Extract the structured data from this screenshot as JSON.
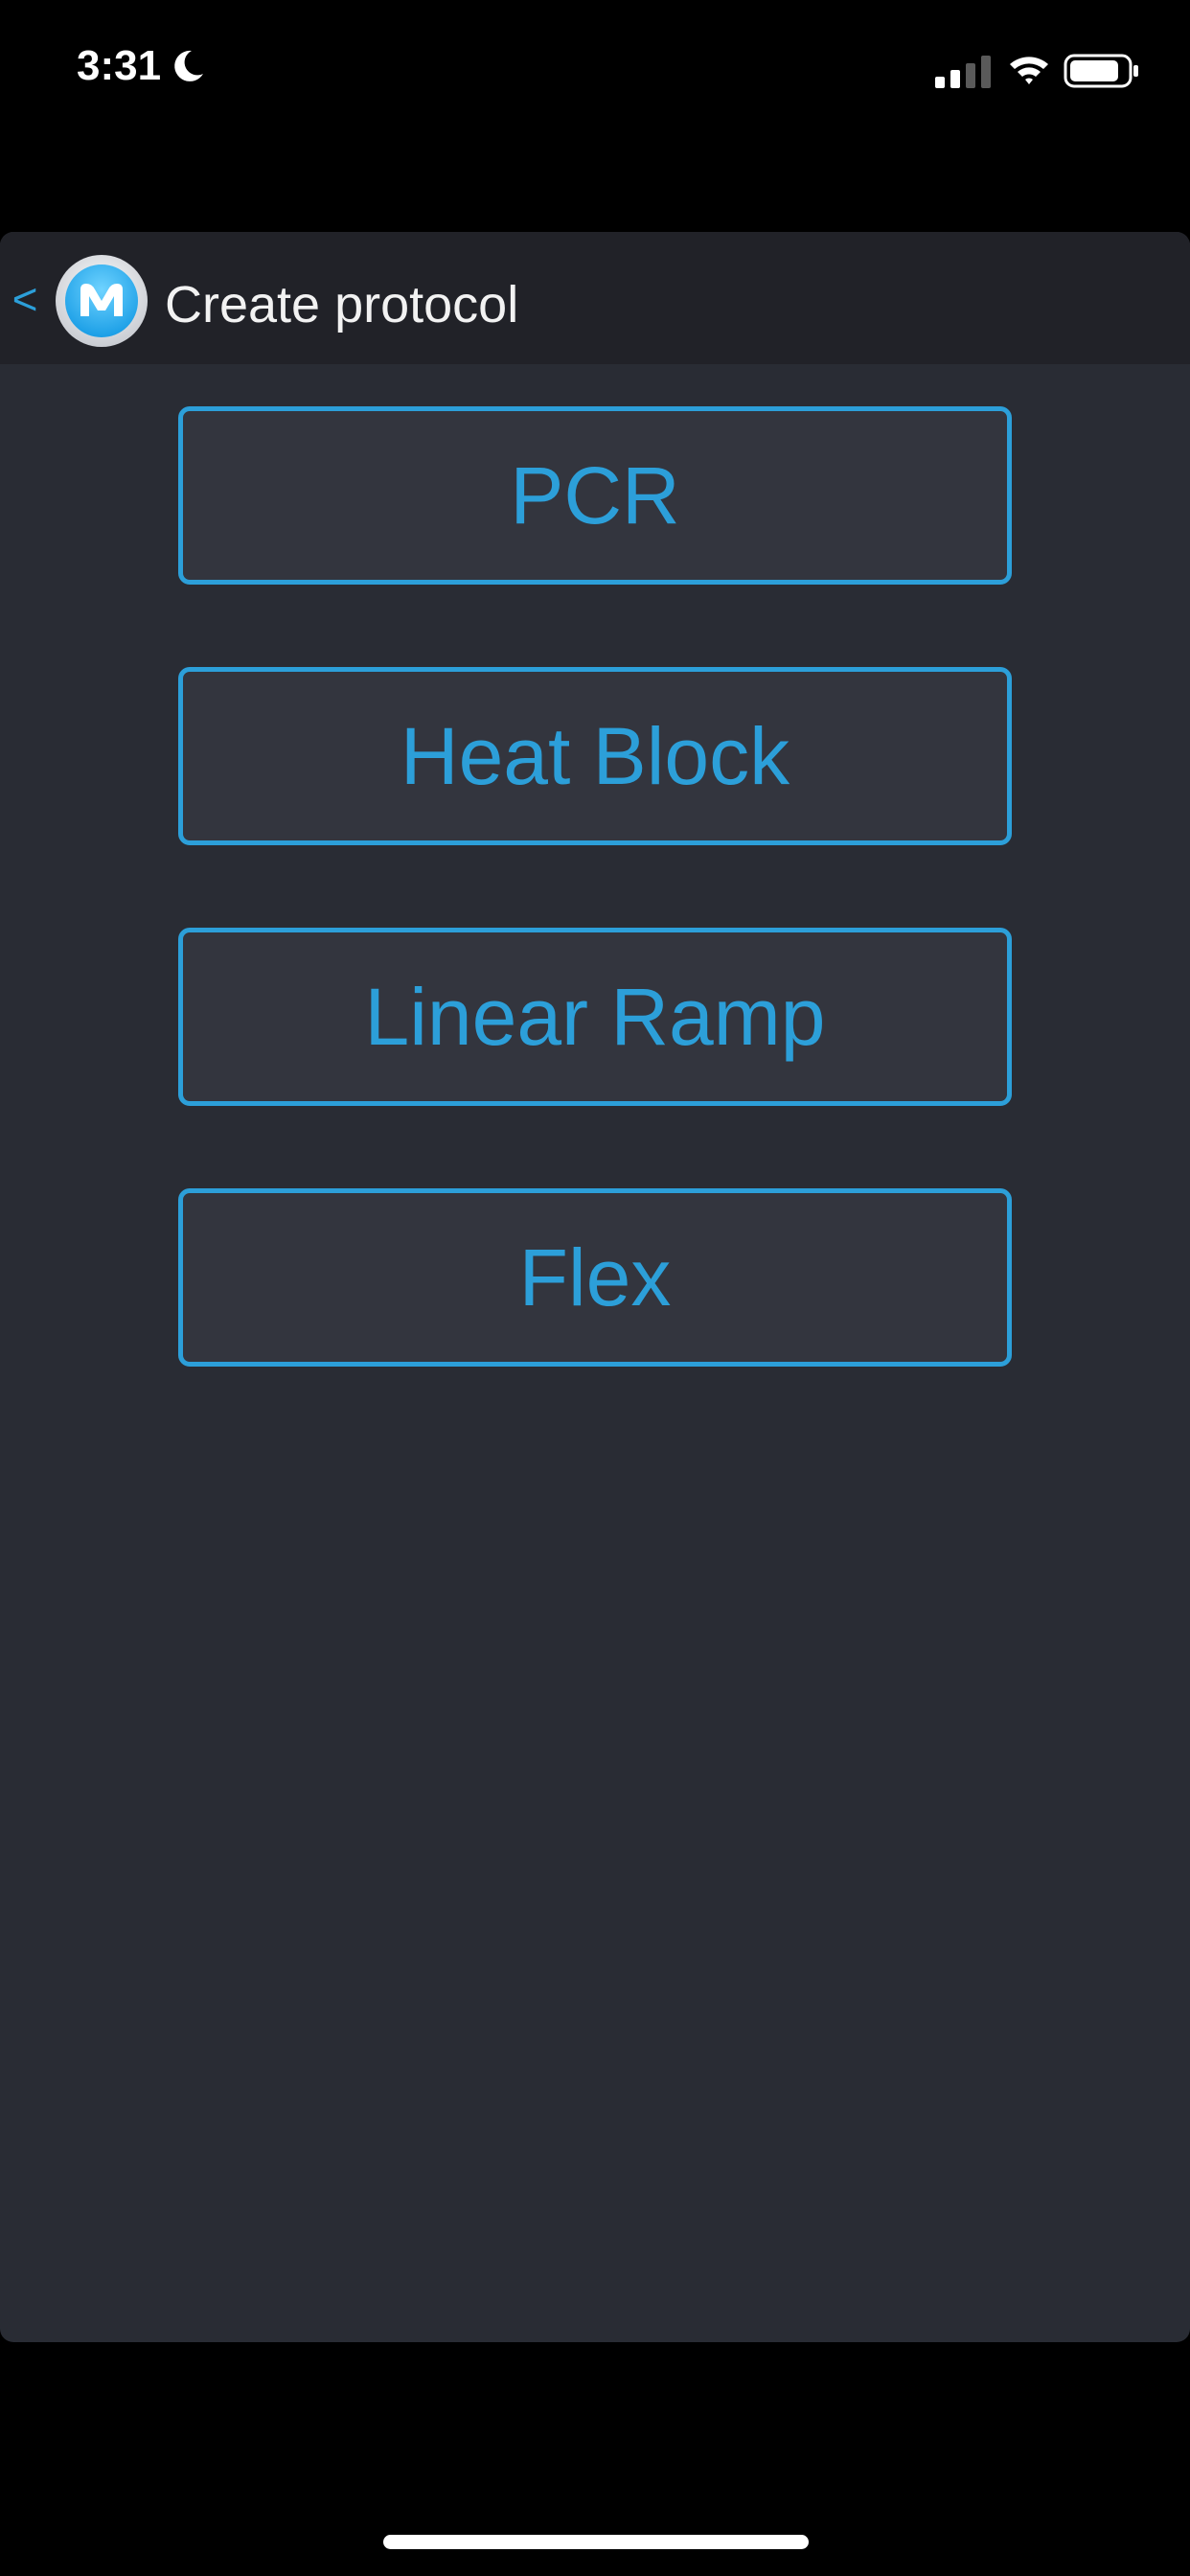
{
  "status_bar": {
    "time": "3:31",
    "icons": [
      "moon-icon",
      "signal-icon",
      "wifi-icon",
      "battery-icon"
    ]
  },
  "header": {
    "back_label": "<",
    "title": "Create protocol",
    "logo_icon": "app-logo-icon"
  },
  "options": [
    {
      "label": "PCR"
    },
    {
      "label": "Heat Block"
    },
    {
      "label": "Linear Ramp"
    },
    {
      "label": "Flex"
    }
  ],
  "colors": {
    "accent": "#2c9fd9",
    "panel_background": "#292c34",
    "header_background": "#212228",
    "button_background": "#33353e"
  }
}
